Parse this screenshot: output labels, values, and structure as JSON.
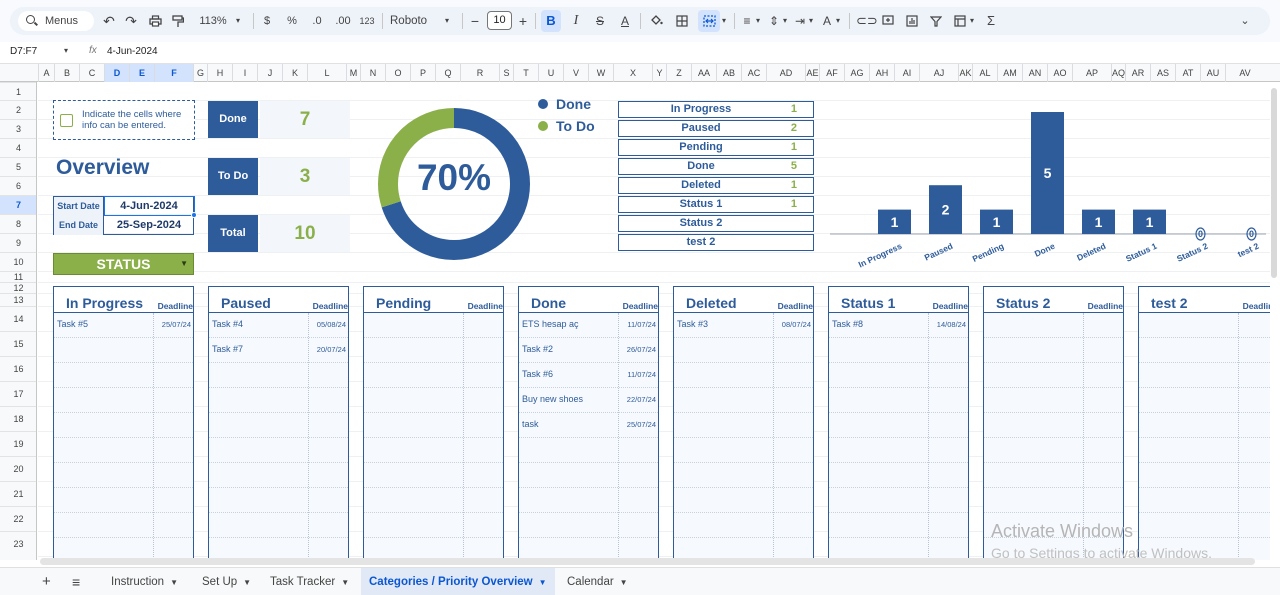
{
  "toolbar": {
    "menus_label": "Menus",
    "zoom": "113%",
    "currency": "$",
    "percent": "%",
    "dec_decrease": ".0",
    "dec_increase": ".00",
    "number_format": "123",
    "font": "Roboto",
    "font_size": "10"
  },
  "formula_bar": {
    "name_box": "D7:F7",
    "value": "4-Jun-2024"
  },
  "columns": [
    "A",
    "B",
    "C",
    "D",
    "E",
    "F",
    "G",
    "H",
    "I",
    "J",
    "K",
    "L",
    "M",
    "N",
    "O",
    "P",
    "Q",
    "R",
    "S",
    "T",
    "U",
    "V",
    "W",
    "X",
    "Y",
    "Z",
    "AA",
    "AB",
    "AC",
    "AD",
    "AE",
    "AF",
    "AG",
    "AH",
    "AI",
    "AJ",
    "AK",
    "AL",
    "AM",
    "AN",
    "AO",
    "AP",
    "AQ",
    "AR",
    "AS",
    "AT",
    "AU",
    "AV"
  ],
  "rows": [
    "1",
    "2",
    "3",
    "4",
    "5",
    "6",
    "7",
    "8",
    "9",
    "10",
    "11",
    "12",
    "13",
    "14",
    "15",
    "16",
    "17",
    "18",
    "19",
    "20",
    "21",
    "22",
    "23"
  ],
  "legend_note": "Indicate the cells where info can be entered.",
  "overview_title": "Overview",
  "dates": {
    "start_label": "Start Date",
    "start_value": "4-Jun-2024",
    "end_label": "End Date",
    "end_value": "25-Sep-2024"
  },
  "status_dropdown": "STATUS",
  "counters": [
    {
      "label": "Done",
      "value": "7"
    },
    {
      "label": "To Do",
      "value": "3"
    },
    {
      "label": "Total",
      "value": "10"
    }
  ],
  "donut": {
    "percent_label": "70%",
    "done_fraction": 0.7,
    "legend": [
      "Done",
      "To Do"
    ],
    "colors": {
      "done": "#2e5c9a",
      "todo": "#8bb04a"
    }
  },
  "status_table": [
    {
      "label": "In Progress",
      "value": "1"
    },
    {
      "label": "Paused",
      "value": "2"
    },
    {
      "label": "Pending",
      "value": "1"
    },
    {
      "label": "Done",
      "value": "5"
    },
    {
      "label": "Deleted",
      "value": "1"
    },
    {
      "label": "Status 1",
      "value": "1"
    },
    {
      "label": "Status 2",
      "value": ""
    },
    {
      "label": "test 2",
      "value": ""
    }
  ],
  "chart_data": {
    "type": "bar",
    "categories": [
      "In Progress",
      "Paused",
      "Pending",
      "Done",
      "Deleted",
      "Status 1",
      "Status 2",
      "test 2"
    ],
    "values": [
      1,
      2,
      1,
      5,
      1,
      1,
      0,
      0
    ],
    "color": "#2e5c9a",
    "title": "",
    "xlabel": "",
    "ylabel": "",
    "ylim": [
      0,
      5
    ]
  },
  "deadline_label": "Deadline",
  "board": [
    {
      "title": "In Progress",
      "tasks": [
        {
          "name": "Task #5",
          "deadline": "25/07/24"
        }
      ]
    },
    {
      "title": "Paused",
      "tasks": [
        {
          "name": "Task #4",
          "deadline": "05/08/24"
        },
        {
          "name": "Task #7",
          "deadline": "20/07/24"
        }
      ]
    },
    {
      "title": "Pending",
      "tasks": []
    },
    {
      "title": "Done",
      "tasks": [
        {
          "name": "ETS hesap aç",
          "deadline": "11/07/24"
        },
        {
          "name": "Task #2",
          "deadline": "26/07/24"
        },
        {
          "name": "Task #6",
          "deadline": "11/07/24"
        },
        {
          "name": "Buy new shoes",
          "deadline": "22/07/24"
        },
        {
          "name": "task",
          "deadline": "25/07/24"
        }
      ]
    },
    {
      "title": "Deleted",
      "tasks": [
        {
          "name": "Task #3",
          "deadline": "08/07/24"
        }
      ]
    },
    {
      "title": "Status 1",
      "tasks": [
        {
          "name": "Task #8",
          "deadline": "14/08/24"
        }
      ]
    },
    {
      "title": "Status 2",
      "tasks": []
    },
    {
      "title": "test 2",
      "tasks": []
    }
  ],
  "watermark": {
    "line1": "Activate Windows",
    "line2": "Go to Settings to activate Windows."
  },
  "sheet_tabs": [
    {
      "label": "Instruction",
      "active": false
    },
    {
      "label": "Set Up",
      "active": false
    },
    {
      "label": "Task Tracker",
      "active": false
    },
    {
      "label": "Categories / Priority Overview",
      "active": true
    },
    {
      "label": "Calendar",
      "active": false
    }
  ]
}
